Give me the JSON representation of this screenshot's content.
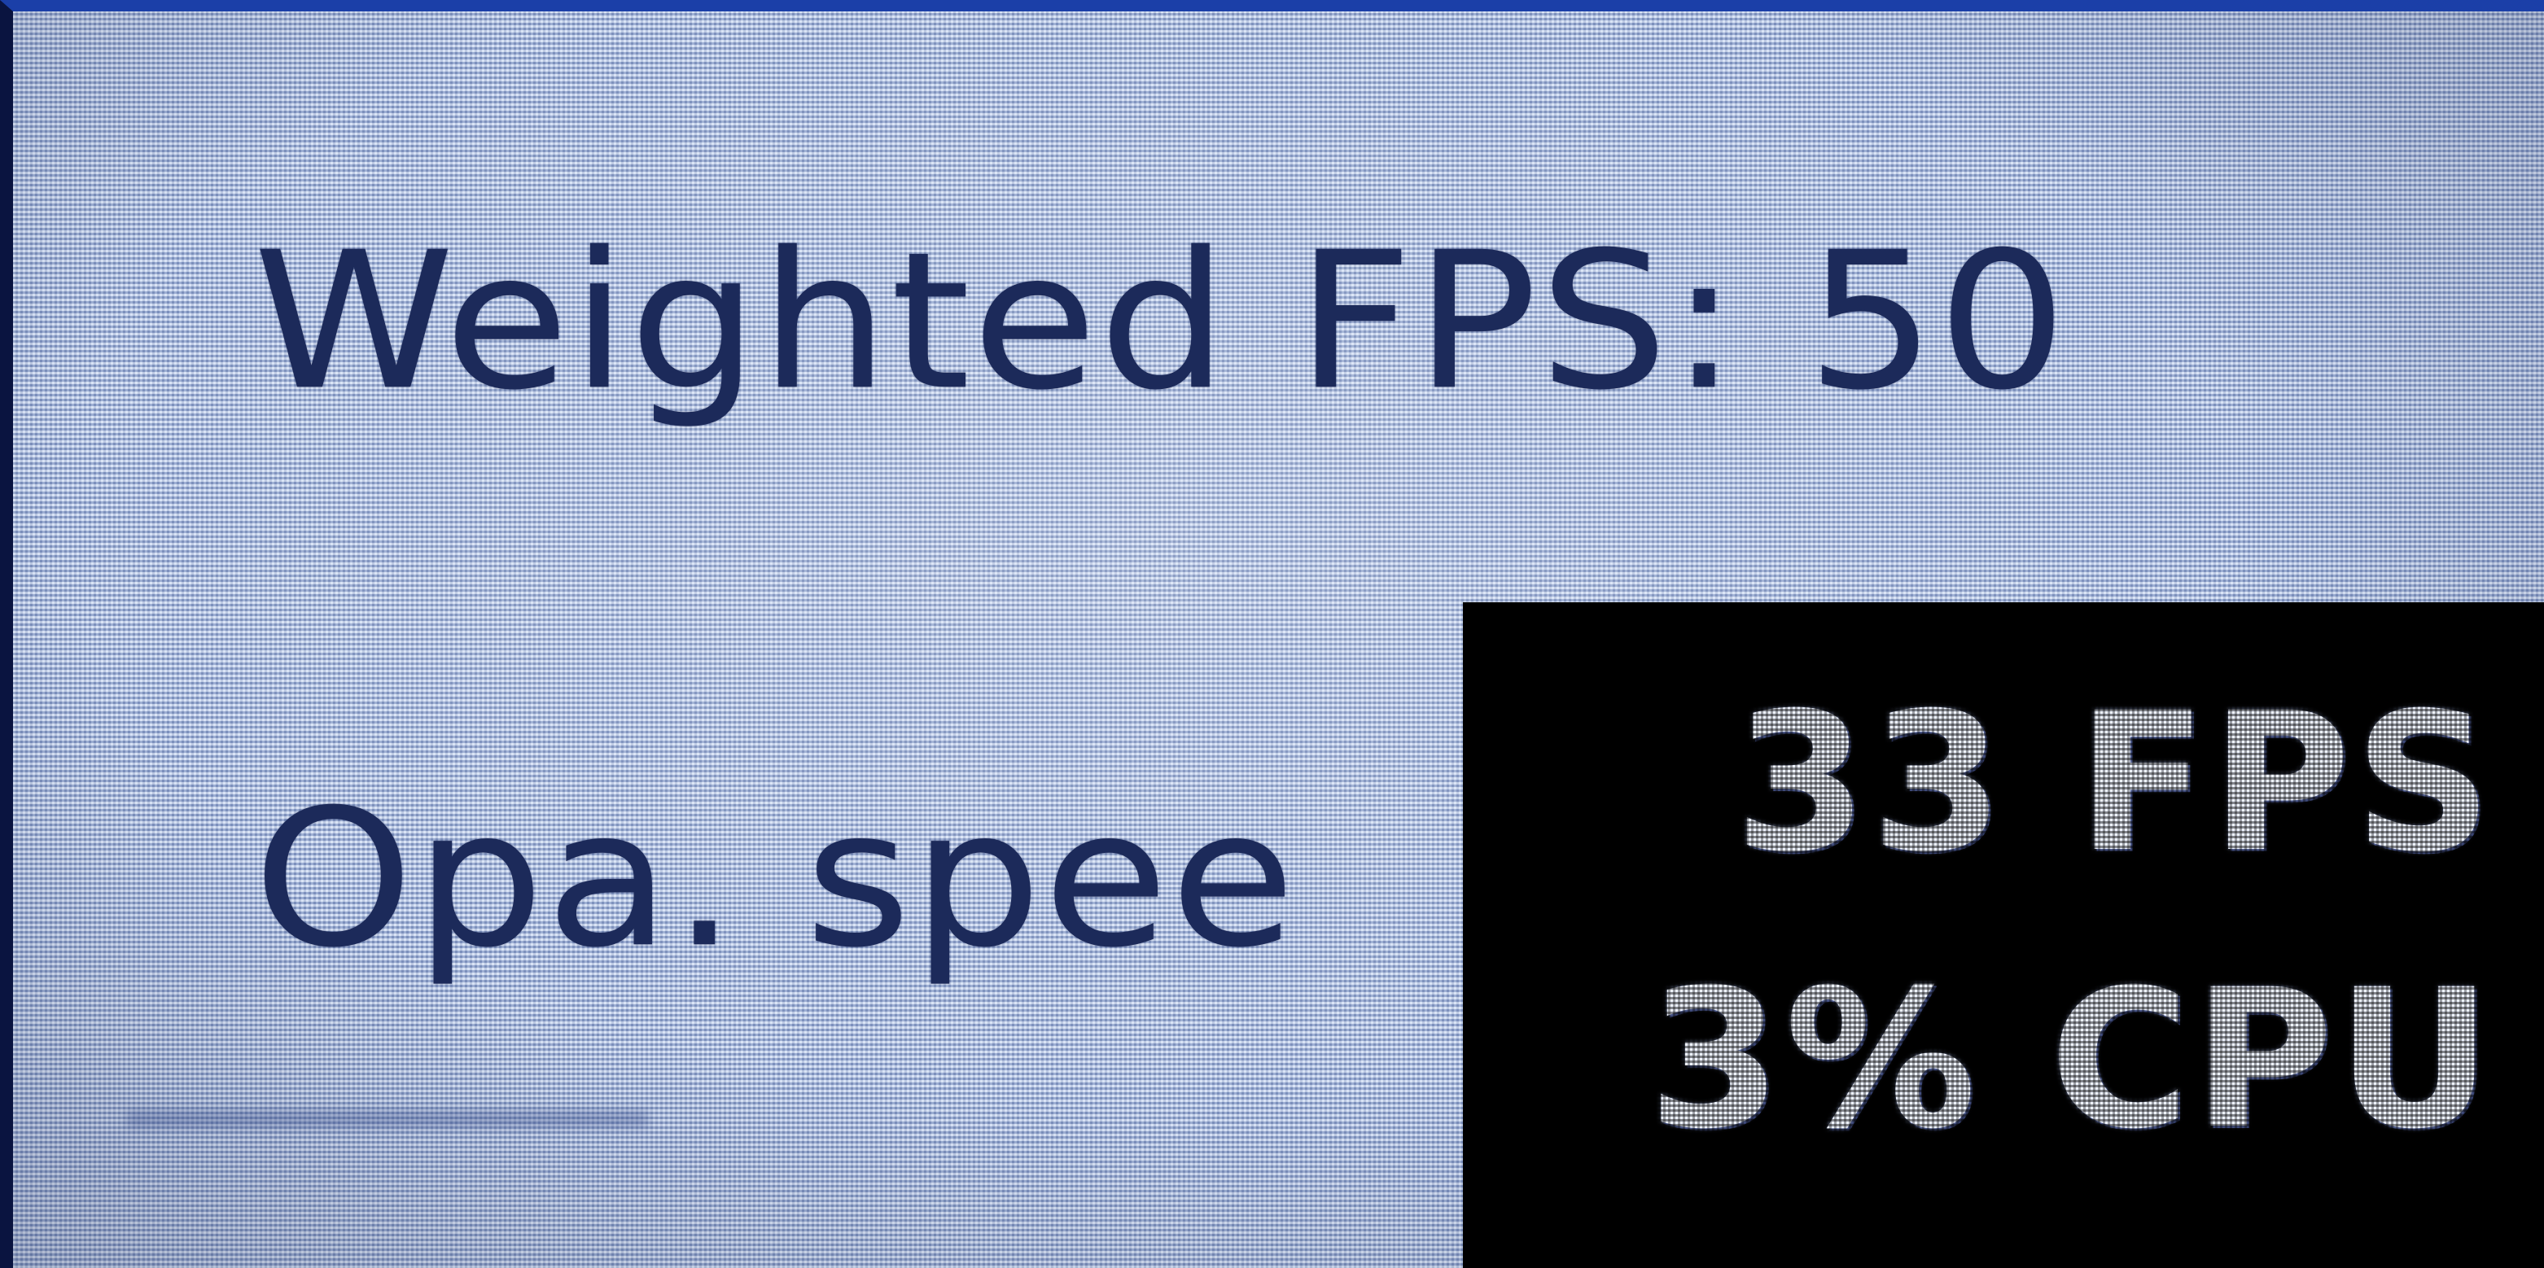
{
  "stats": {
    "weighted_fps": "Weighted FPS: 50",
    "opa_speed": "Opa. spee"
  },
  "perf_monitor": {
    "fps": "33 FPS",
    "cpu": "3% CPU"
  },
  "colors": {
    "screen_background": "#b9cdef",
    "label_text": "#1c2a5a",
    "monitor_background": "#000000",
    "monitor_text": "#eef3ff"
  }
}
